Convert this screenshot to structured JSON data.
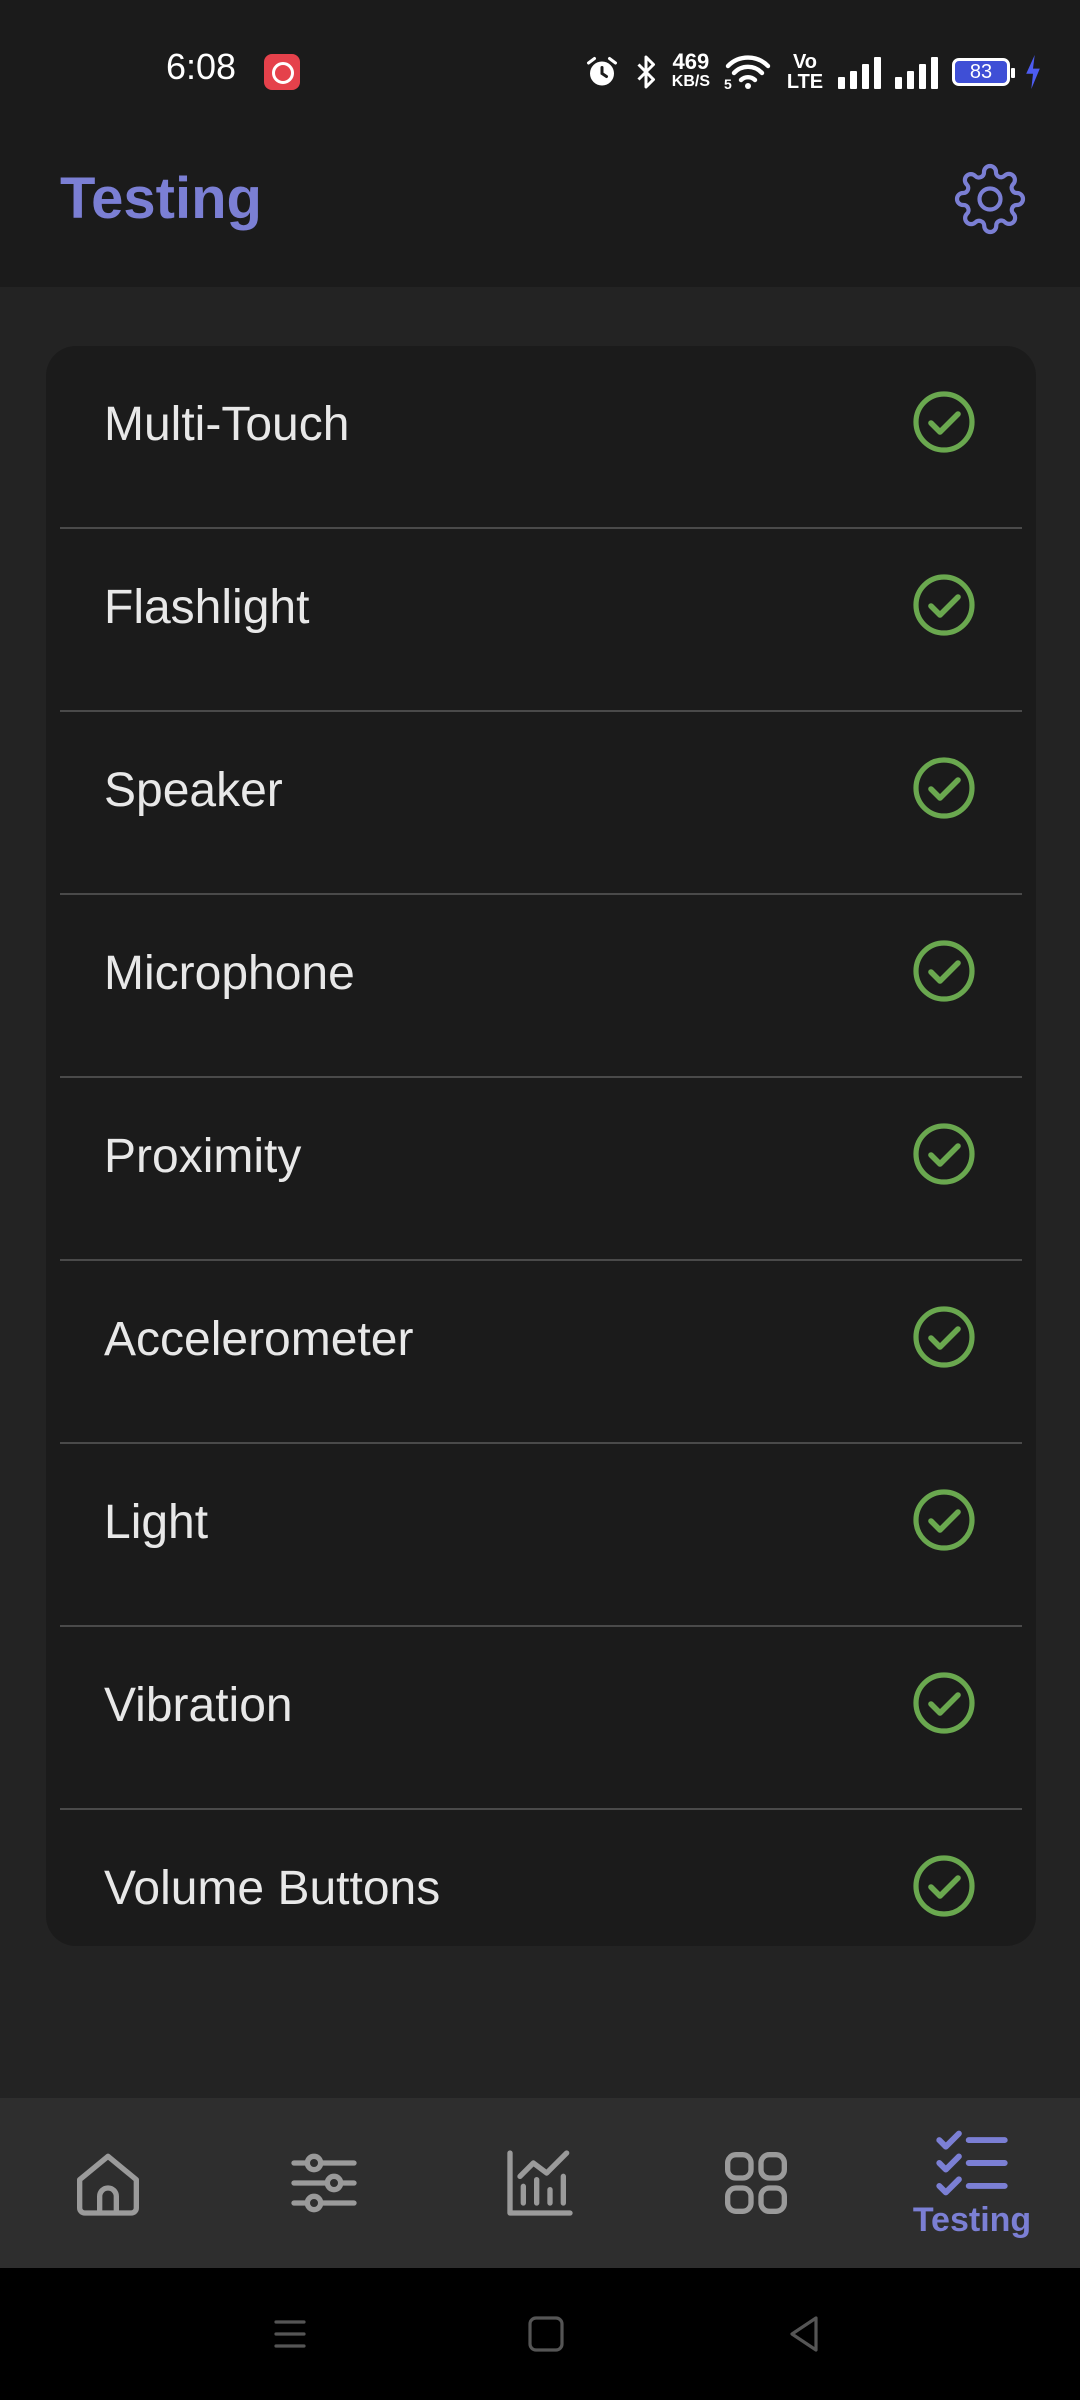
{
  "status_bar": {
    "time": "6:08",
    "net_speed_value": "469",
    "net_speed_unit": "KB/S",
    "wifi_badge": "5",
    "volte": "Vo LTE",
    "battery": "83"
  },
  "app_bar": {
    "title": "Testing",
    "settings_icon": "gear-icon"
  },
  "tests": [
    {
      "label": "Multi-Touch",
      "status": "passed"
    },
    {
      "label": "Flashlight",
      "status": "passed"
    },
    {
      "label": "Speaker",
      "status": "passed"
    },
    {
      "label": "Microphone",
      "status": "passed"
    },
    {
      "label": "Proximity",
      "status": "passed"
    },
    {
      "label": "Accelerometer",
      "status": "passed"
    },
    {
      "label": "Light",
      "status": "passed"
    },
    {
      "label": "Vibration",
      "status": "passed"
    },
    {
      "label": "Volume Buttons",
      "status": "passed"
    }
  ],
  "bottom_nav": {
    "items": [
      {
        "icon": "home-icon",
        "active": false
      },
      {
        "icon": "sliders-icon",
        "active": false
      },
      {
        "icon": "chart-icon",
        "active": false
      },
      {
        "icon": "grid-icon",
        "active": false
      },
      {
        "icon": "checklist-icon",
        "label": "Testing",
        "active": true
      }
    ]
  },
  "colors": {
    "accent": "#7b7fd4",
    "check_green": "#6aa84f",
    "background": "#232323",
    "card": "#1b1b1b"
  }
}
